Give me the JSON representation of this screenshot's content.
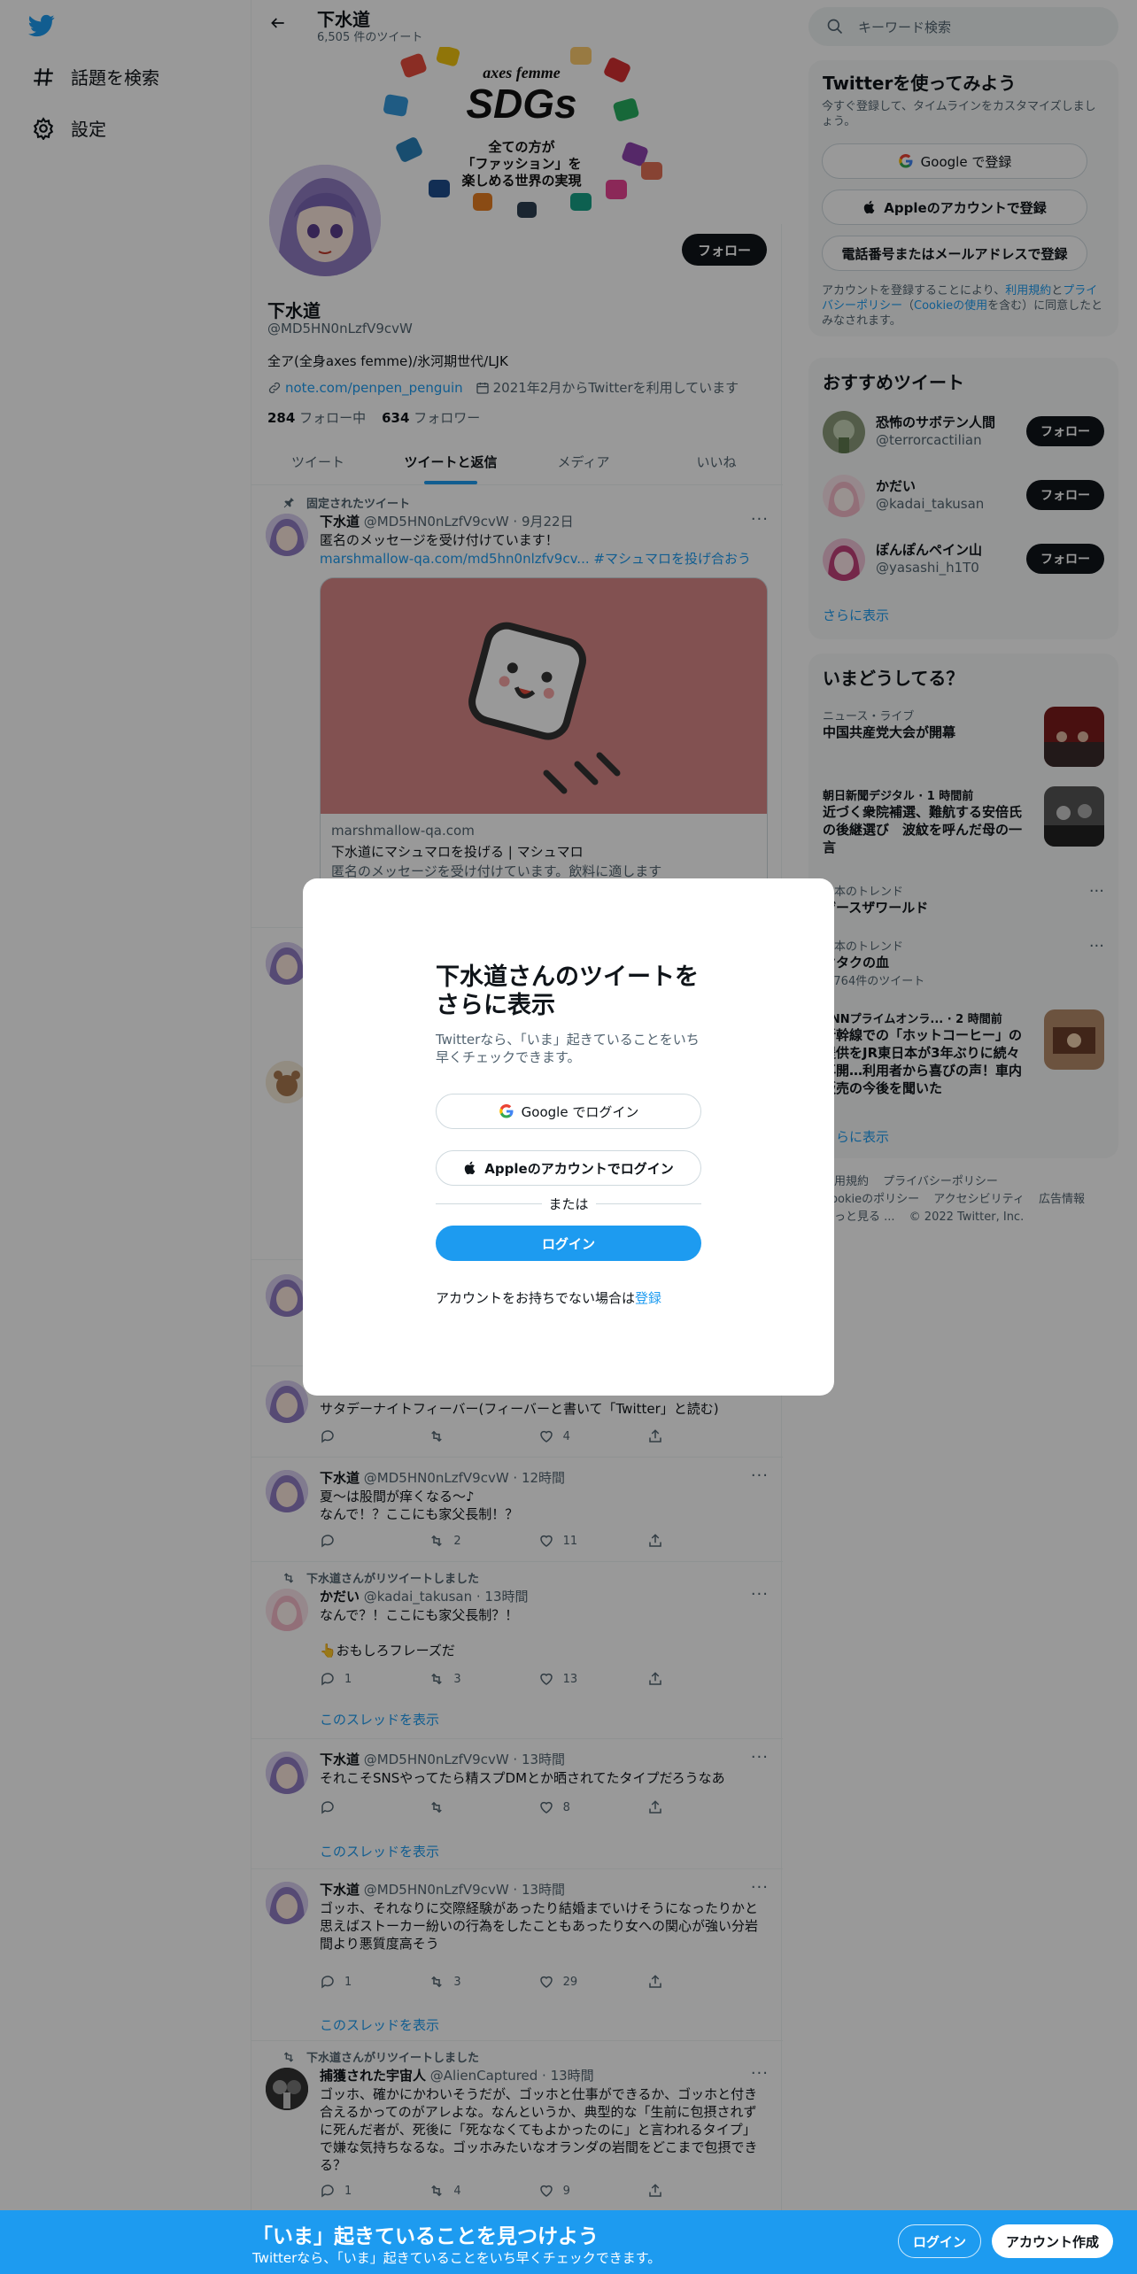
{
  "nav": {
    "explore": "話題を検索",
    "settings": "設定"
  },
  "header": {
    "name": "下水道",
    "count": "6,505 件のツイート"
  },
  "banner": {
    "brand": "axes femme",
    "big": "SDGs",
    "line1": "全ての方が",
    "line2": "「ファッション」を",
    "line3": "楽しめる世界の実現"
  },
  "profile": {
    "name": "下水道",
    "handle": "@MD5HN0nLzfV9cvW",
    "bio": "全ア(全身axes femme)/氷河期世代/LJK",
    "link": "note.com/penpen_penguin",
    "joined": "2021年2月からTwitterを利用しています",
    "following_count": "284",
    "following_label": "フォロー中",
    "followers_count": "634",
    "followers_label": "フォロワー",
    "follow": "フォロー"
  },
  "tabs": [
    "ツイート",
    "ツイートと返信",
    "メディア",
    "いいね"
  ],
  "pinned": {
    "ctx": "固定されたツイート",
    "name": "下水道",
    "meta": "@MD5HN0nLzfV9cvW · 9月22日",
    "text": "匿名のメッセージを受け付けています！",
    "link": "marshmallow-qa.com/md5hn0nlzfv9cv...",
    "hashtag": "#マシュマロを投げ合おう",
    "card_domain": "marshmallow-qa.com",
    "card_title": "下水道にマシュマロを投げる | マシュマロ",
    "card_desc": "匿名のメッセージを受け付けています。飲料に適します"
  },
  "tweets": [
    {
      "text": "サタデーナイトフィーバー(フィーバーと書いて「Twitter」と読む)",
      "reply": "",
      "retweet": "",
      "like": "4"
    },
    {
      "name": "下水道",
      "meta": "@MD5HN0nLzfV9cvW · 12時間",
      "text": "夏～は股間が痒くなる～♪\nなんで！？ここにも家父長制！？",
      "reply": "",
      "retweet": "2",
      "like": "11"
    },
    {
      "ctx": "下水道さんがリツイートしました",
      "name": "かだい",
      "meta": "@kadai_takusan · 13時間",
      "text": "なんで？！ここにも家父長制？！\n\n👆おもしろフレーズだ",
      "reply": "1",
      "retweet": "3",
      "like": "13",
      "thread": "このスレッドを表示"
    },
    {
      "name": "下水道",
      "meta": "@MD5HN0nLzfV9cvW · 13時間",
      "text": "それこそSNSやってたら精スプDMとか晒されてたタイプだろうなあ",
      "reply": "",
      "retweet": "",
      "like": "8",
      "thread": "このスレッドを表示"
    },
    {
      "name": "下水道",
      "meta": "@MD5HN0nLzfV9cvW · 13時間",
      "text": "ゴッホ、それなりに交際経験があったり結婚までいけそうになったりかと思えばストーカー紛いの行為をしたこともあったり女への関心が強い分岩間より悪質度高そう",
      "reply": "1",
      "retweet": "3",
      "like": "29",
      "thread": "このスレッドを表示"
    },
    {
      "ctx": "下水道さんがリツイートしました",
      "name": "捕獲された宇宙人",
      "meta": "@AlienCaptured · 13時間",
      "text": "ゴッホ、確かにかわいそうだが、ゴッホと仕事ができるか、ゴッホと付き合えるかってのがアレよな。なんというか、典型的な「生前に包摂されずに死んだ者が、死後に「死ななくてもよかったのに」と言われるタイプ」で嫌な気持ちなるな。ゴッホみたいなオランダの岩間をどこまで包摂できる？",
      "reply": "1",
      "retweet": "4",
      "like": "9"
    }
  ],
  "sidebar": {
    "search_placeholder": "キーワード検索",
    "signup_title": "Twitterを使ってみよう",
    "signup_sub": "今すぐ登録して、タイムラインをカスタマイズしましょう。",
    "google": "Google で登録",
    "apple": "Appleのアカウントで登録",
    "phone": "電話番号またはメールアドレスで登録",
    "terms_pre": "アカウントを登録することにより、",
    "terms_link": "利用規約",
    "terms_mid": "と",
    "privacy_link": "プライバシーポリシー",
    "cookie_pre": "（",
    "cookie_link": "Cookieの使用",
    "terms_post": "を含む）に同意したとみなされます。",
    "rec_title": "おすすめツイート",
    "recs": [
      {
        "name": "恐怖のサボテン人間",
        "handle": "@terrorcactilian",
        "btn": "フォロー"
      },
      {
        "name": "かだい",
        "handle": "@kadai_takusan",
        "btn": "フォロー"
      },
      {
        "name": "ぽんぽんペイン山",
        "handle": "@yasashi_h1T0",
        "btn": "フォロー"
      }
    ],
    "more": "さらに表示",
    "trend_title": "いまどうしてる？",
    "trends": [
      {
        "cat": "ニュース・ライブ",
        "title": "中国共産党大会が開幕"
      },
      {
        "cat": "朝日新聞デジタル · 1 時間前",
        "title": "近づく衆院補選、難航する安倍氏の後継選び　波紋を呼んだ母の一言"
      },
      {
        "cat": "日本のトレンド",
        "title": "ザースザワールド"
      },
      {
        "cat": "日本のトレンド",
        "title": "オタクの血",
        "count": "3,764件のツイート"
      },
      {
        "cat": "FNNプライムオンラ... · 2 時間前",
        "title": "新幹線での「ホットコーヒー」の提供をJR東日本が3年ぶりに続々再開…利用者から喜びの声！車内販売の今後を聞いた"
      }
    ],
    "more2": "さらに表示",
    "footer": [
      "利用規約",
      "プライバシーポリシー",
      "Cookieのポリシー",
      "アクセシビリティ",
      "広告情報",
      "もっと見る ...",
      "© 2022 Twitter, Inc."
    ]
  },
  "modal": {
    "title": "下水道さんのツイートをさらに表示",
    "sub": "Twitterなら、「いま」起きていることをいち早くチェックできます。",
    "google": "Google でログイン",
    "apple": "Appleのアカウントでログイン",
    "or": "または",
    "login": "ログイン",
    "signup_pre": "アカウントをお持ちでない場合は",
    "signup_link": "登録"
  },
  "bottom": {
    "title": "「いま」起きていることを見つけよう",
    "sub": "Twitterなら、「いま」起きていることをいち早くチェックできます。",
    "login": "ログイン",
    "signup": "アカウント作成"
  },
  "colors": {
    "accent": "#1d9bf0",
    "dark": "#0f1419",
    "muted": "#536471"
  }
}
